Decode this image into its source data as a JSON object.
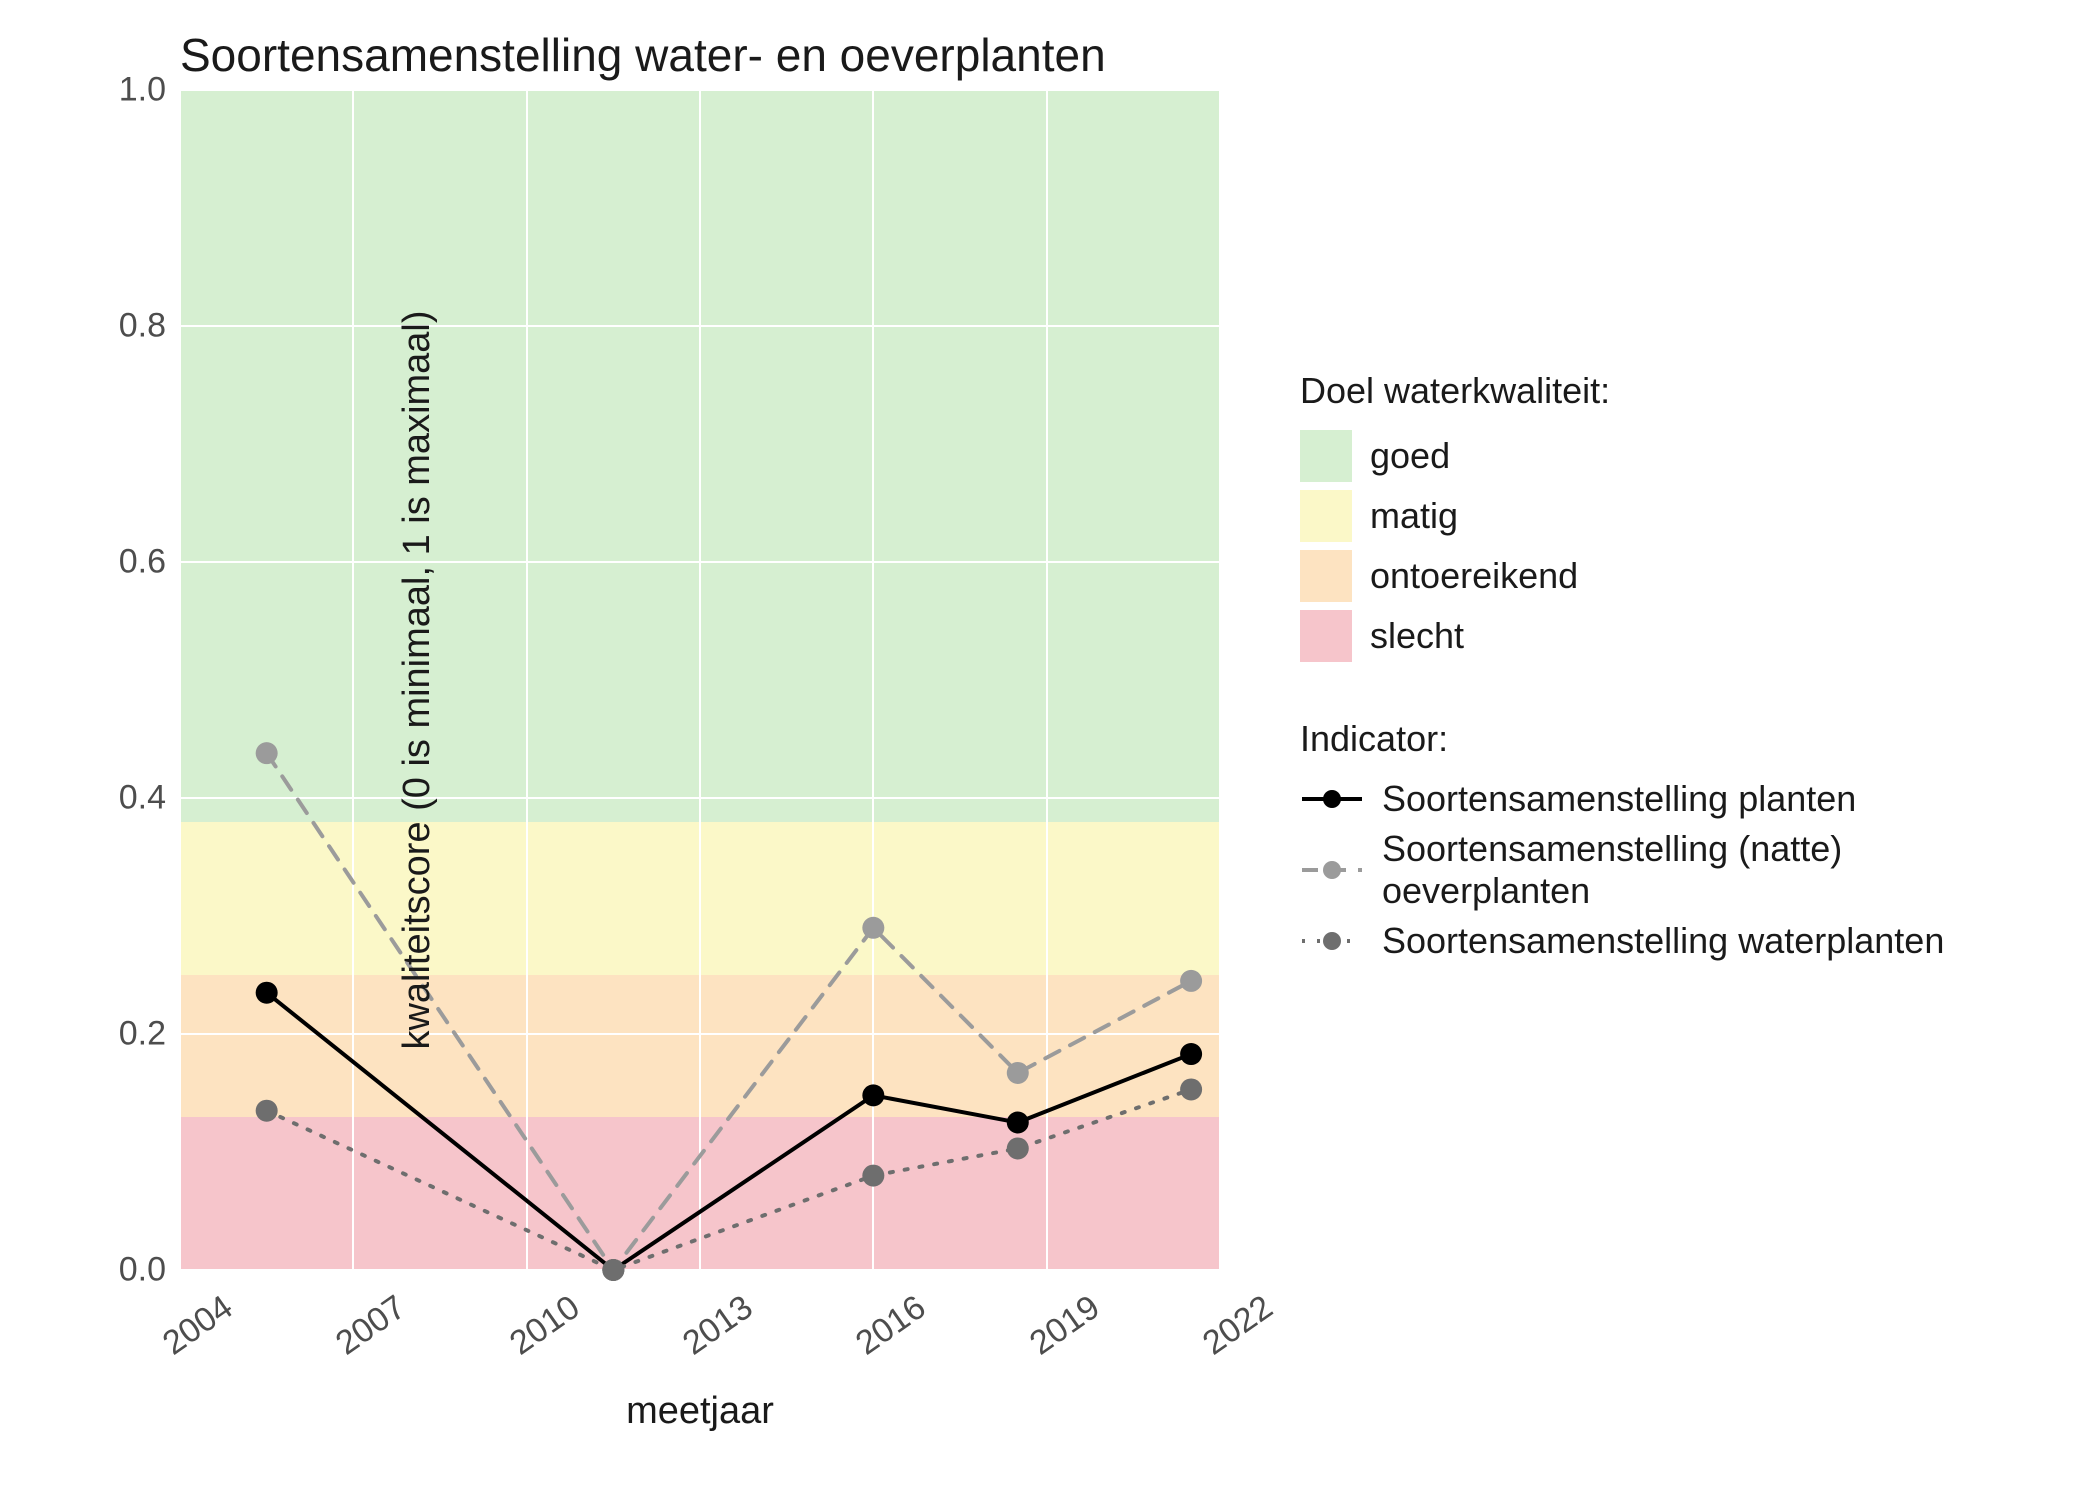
{
  "title": "Soortensamenstelling water- en oeverplanten",
  "xlabel": "meetjaar",
  "ylabel": "kwaliteitscore (0 is minimaal, 1 is maximaal)",
  "legend1_title": "Doel waterkwaliteit:",
  "legend2_title": "Indicator:",
  "bands": {
    "goed": {
      "label": "goed",
      "color": "#d6efd1",
      "from": 0.38,
      "to": 1.0
    },
    "matig": {
      "label": "matig",
      "color": "#fbf8c8",
      "from": 0.25,
      "to": 0.38
    },
    "ontoereikend": {
      "label": "ontoereikend",
      "color": "#fde3c1",
      "from": 0.13,
      "to": 0.25
    },
    "slecht": {
      "label": "slecht",
      "color": "#f6c5cb",
      "from": 0.0,
      "to": 0.13
    }
  },
  "y_ticks": [
    0.0,
    0.2,
    0.4,
    0.6,
    0.8,
    1.0
  ],
  "x_ticks": [
    2004,
    2007,
    2010,
    2013,
    2016,
    2019,
    2022
  ],
  "chart_data": {
    "type": "line",
    "xlim": [
      2004,
      2022
    ],
    "ylim": [
      0.0,
      1.0
    ],
    "xlabel": "meetjaar",
    "ylabel": "kwaliteitscore (0 is minimaal, 1 is maximaal)",
    "title": "Soortensamenstelling water- en oeverplanten",
    "bands": [
      {
        "name": "goed",
        "from": 0.38,
        "to": 1.0,
        "color": "#d6efd1"
      },
      {
        "name": "matig",
        "from": 0.25,
        "to": 0.38,
        "color": "#fbf8c8"
      },
      {
        "name": "ontoereikend",
        "from": 0.13,
        "to": 0.25,
        "color": "#fde3c1"
      },
      {
        "name": "slecht",
        "from": 0.0,
        "to": 0.13,
        "color": "#f6c5cb"
      }
    ],
    "x": [
      2005.5,
      2011.5,
      2016,
      2018.5,
      2021.5
    ],
    "series": [
      {
        "name": "Soortensamenstelling planten",
        "color": "#000000",
        "dash": "solid",
        "values": [
          0.235,
          0.0,
          0.148,
          0.125,
          0.183
        ]
      },
      {
        "name": "Soortensamenstelling (natte) oeverplanten",
        "color": "#9b9b9b",
        "dash": "dashed",
        "values": [
          0.438,
          0.0,
          0.29,
          0.167,
          0.245
        ]
      },
      {
        "name": "Soortensamenstelling waterplanten",
        "color": "#6e6e6e",
        "dash": "dotted",
        "values": [
          0.135,
          0.0,
          0.08,
          0.103,
          0.153
        ]
      }
    ]
  }
}
